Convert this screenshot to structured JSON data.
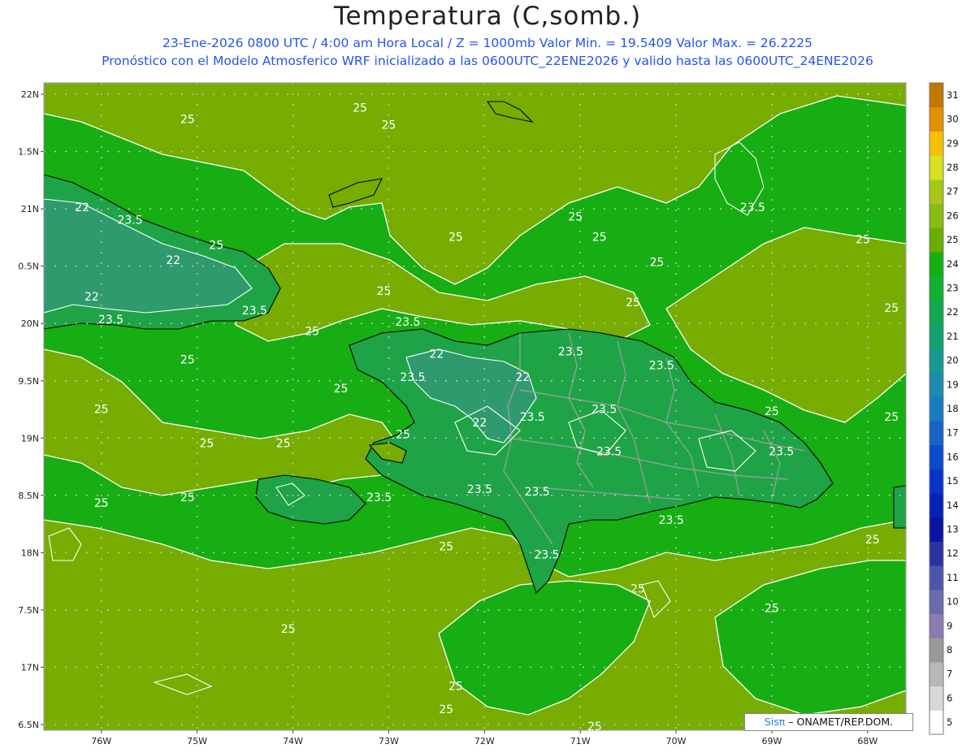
{
  "header": {
    "title": "Temperatura (C,somb.)",
    "line1": "23-Ene-2026  0800 UTC / 4:00 am Hora Local / Z = 1000mb    Valor Min. = 19.5409  Valor Max. = 26.2225",
    "line2": "Pronóstico con el Modelo Atmosferico WRF inicializado a las 0600UTC_22ENE2026 y valido hasta las  0600UTC_24ENE2026"
  },
  "map": {
    "lon_range": [
      -76.6,
      -67.6
    ],
    "lat_range": [
      16.45,
      22.1
    ],
    "lat_ticks": [
      {
        "value": 22.0,
        "label": "22N"
      },
      {
        "value": 21.5,
        "label": "1.5N"
      },
      {
        "value": 21.0,
        "label": "21N"
      },
      {
        "value": 20.5,
        "label": "0.5N"
      },
      {
        "value": 20.0,
        "label": "20N"
      },
      {
        "value": 19.5,
        "label": "9.5N"
      },
      {
        "value": 19.0,
        "label": "19N"
      },
      {
        "value": 18.5,
        "label": "8.5N"
      },
      {
        "value": 18.0,
        "label": "18N"
      },
      {
        "value": 17.5,
        "label": "7.5N"
      },
      {
        "value": 17.0,
        "label": "17N"
      },
      {
        "value": 16.5,
        "label": "6.5N"
      }
    ],
    "lon_ticks": [
      {
        "value": -76,
        "label": "76W"
      },
      {
        "value": -75,
        "label": "75W"
      },
      {
        "value": -74,
        "label": "74W"
      },
      {
        "value": -73,
        "label": "73W"
      },
      {
        "value": -72,
        "label": "72W"
      },
      {
        "value": -71,
        "label": "71W"
      },
      {
        "value": -70,
        "label": "70W"
      },
      {
        "value": -69,
        "label": "69W"
      },
      {
        "value": -68,
        "label": "68W"
      }
    ],
    "contour_labels": [
      {
        "lon": -73.3,
        "lat": 21.85,
        "text": "25"
      },
      {
        "lon": -75.1,
        "lat": 21.75,
        "text": "25"
      },
      {
        "lon": -73.0,
        "lat": 21.7,
        "text": "25"
      },
      {
        "lon": -76.2,
        "lat": 20.98,
        "text": "22"
      },
      {
        "lon": -75.7,
        "lat": 20.87,
        "text": "23.5"
      },
      {
        "lon": -74.8,
        "lat": 20.65,
        "text": "25"
      },
      {
        "lon": -75.25,
        "lat": 20.52,
        "text": "22"
      },
      {
        "lon": -76.1,
        "lat": 20.2,
        "text": "22"
      },
      {
        "lon": -74.4,
        "lat": 20.08,
        "text": "23.5"
      },
      {
        "lon": -75.9,
        "lat": 20.0,
        "text": "23.5"
      },
      {
        "lon": -73.8,
        "lat": 19.9,
        "text": "25"
      },
      {
        "lon": -75.1,
        "lat": 19.65,
        "text": "25"
      },
      {
        "lon": -76.0,
        "lat": 19.22,
        "text": "25"
      },
      {
        "lon": -72.8,
        "lat": 19.98,
        "text": "23.5"
      },
      {
        "lon": -72.5,
        "lat": 19.7,
        "text": "22"
      },
      {
        "lon": -71.1,
        "lat": 19.72,
        "text": "23.5"
      },
      {
        "lon": -72.75,
        "lat": 19.5,
        "text": "23.5"
      },
      {
        "lon": -71.6,
        "lat": 19.5,
        "text": "22"
      },
      {
        "lon": -72.05,
        "lat": 19.1,
        "text": "22"
      },
      {
        "lon": -71.5,
        "lat": 19.15,
        "text": "23.5"
      },
      {
        "lon": -70.75,
        "lat": 19.22,
        "text": "23.5"
      },
      {
        "lon": -70.15,
        "lat": 19.6,
        "text": "23.5"
      },
      {
        "lon": -69.0,
        "lat": 19.2,
        "text": "25"
      },
      {
        "lon": -73.5,
        "lat": 19.4,
        "text": "25"
      },
      {
        "lon": -72.85,
        "lat": 19.0,
        "text": "25"
      },
      {
        "lon": -74.9,
        "lat": 18.92,
        "text": "25"
      },
      {
        "lon": -74.1,
        "lat": 18.92,
        "text": "25"
      },
      {
        "lon": -70.7,
        "lat": 18.85,
        "text": "23.5"
      },
      {
        "lon": -68.9,
        "lat": 18.85,
        "text": "23.5"
      },
      {
        "lon": -73.1,
        "lat": 18.45,
        "text": "23.5"
      },
      {
        "lon": -72.05,
        "lat": 18.52,
        "text": "23.5"
      },
      {
        "lon": -71.45,
        "lat": 18.5,
        "text": "23.5"
      },
      {
        "lon": -70.05,
        "lat": 18.25,
        "text": "23.5"
      },
      {
        "lon": -75.1,
        "lat": 18.45,
        "text": "25"
      },
      {
        "lon": -76.0,
        "lat": 18.4,
        "text": "25"
      },
      {
        "lon": -72.4,
        "lat": 18.02,
        "text": "25"
      },
      {
        "lon": -71.35,
        "lat": 17.95,
        "text": "23.5"
      },
      {
        "lon": -70.4,
        "lat": 17.65,
        "text": "25"
      },
      {
        "lon": -69.0,
        "lat": 17.48,
        "text": "25"
      },
      {
        "lon": -67.95,
        "lat": 18.08,
        "text": "25"
      },
      {
        "lon": -74.05,
        "lat": 17.3,
        "text": "25"
      },
      {
        "lon": -72.3,
        "lat": 16.8,
        "text": "25"
      },
      {
        "lon": -72.4,
        "lat": 16.6,
        "text": "25"
      },
      {
        "lon": -70.85,
        "lat": 16.45,
        "text": "25"
      },
      {
        "lon": -71.05,
        "lat": 20.9,
        "text": "25"
      },
      {
        "lon": -70.8,
        "lat": 20.72,
        "text": "25"
      },
      {
        "lon": -72.3,
        "lat": 20.72,
        "text": "25"
      },
      {
        "lon": -73.05,
        "lat": 20.25,
        "text": "25"
      },
      {
        "lon": -70.2,
        "lat": 20.5,
        "text": "25"
      },
      {
        "lon": -70.45,
        "lat": 20.15,
        "text": "25"
      },
      {
        "lon": -69.2,
        "lat": 20.98,
        "text": "23.5"
      },
      {
        "lon": -68.05,
        "lat": 20.7,
        "text": "25"
      },
      {
        "lon": -67.75,
        "lat": 20.1,
        "text": "25"
      },
      {
        "lon": -67.75,
        "lat": 19.15,
        "text": "25"
      }
    ]
  },
  "colorbar": {
    "labels": [
      "5",
      "6",
      "7",
      "8",
      "9",
      "10",
      "11",
      "12",
      "13",
      "14",
      "15",
      "16",
      "17",
      "18",
      "19",
      "20",
      "21",
      "22",
      "23",
      "24",
      "25",
      "26",
      "27",
      "28",
      "29",
      "30",
      "31"
    ],
    "colors": [
      "#ffffff",
      "#d8d8d8",
      "#b8b8b8",
      "#9a9a9a",
      "#8a7bb0",
      "#6a6aae",
      "#4e55a8",
      "#2a32a0",
      "#0a14a0",
      "#0522b8",
      "#0535c8",
      "#0a4acc",
      "#1464c8",
      "#1a7cc0",
      "#1a8cb0",
      "#169a90",
      "#12a070",
      "#10a850",
      "#10b030",
      "#12b010",
      "#6aac00",
      "#88bc10",
      "#a8c818",
      "#d8e020",
      "#f8c000",
      "#e09000",
      "#c07800"
    ]
  },
  "colors": {
    "warm_fill": "#76ad00",
    "sea_fill": "#16ae12",
    "land_cool_fill": "#1ea446",
    "land_cold_fill": "#2f9a6e",
    "coastline": "#000000",
    "province_border": "#a0a0a0",
    "contour": "#ffffff",
    "grid": "#c8c8c8"
  },
  "credit": {
    "brand": "Sisπ",
    "org": " – ONAMET/REP.DOM."
  }
}
